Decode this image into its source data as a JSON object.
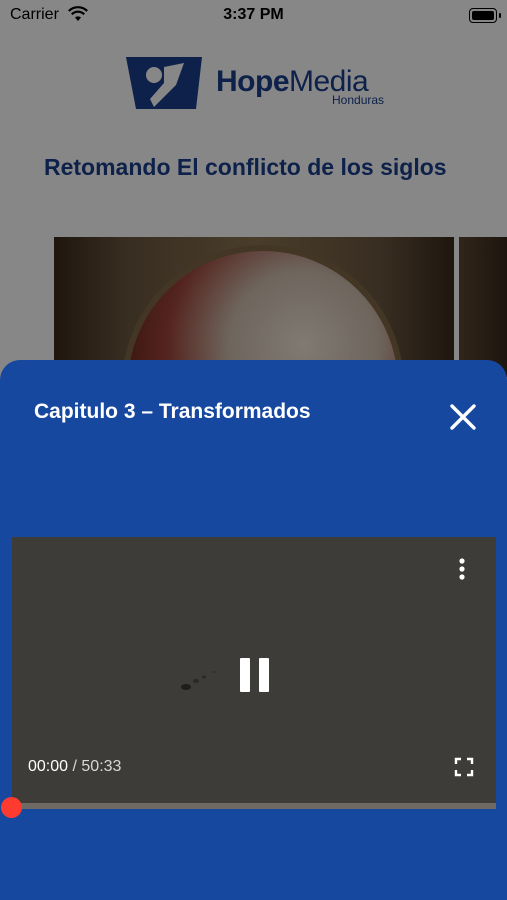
{
  "status_bar": {
    "carrier": "Carrier",
    "time": "3:37 PM"
  },
  "brand": {
    "name_bold": "Hope",
    "name_regular": "Media",
    "sub": "Honduras",
    "color": "#1a3f8c"
  },
  "section": {
    "title": "Retomando El conflicto de los siglos"
  },
  "sheet": {
    "title": "Capitulo 3 – Transformados",
    "background": "#1748a0",
    "close_icon": "close-icon"
  },
  "player": {
    "current_time": "00:00",
    "separator": "/",
    "duration": "50:33",
    "progress": 0,
    "progress_color": "#ff3b30",
    "state": "playing"
  }
}
